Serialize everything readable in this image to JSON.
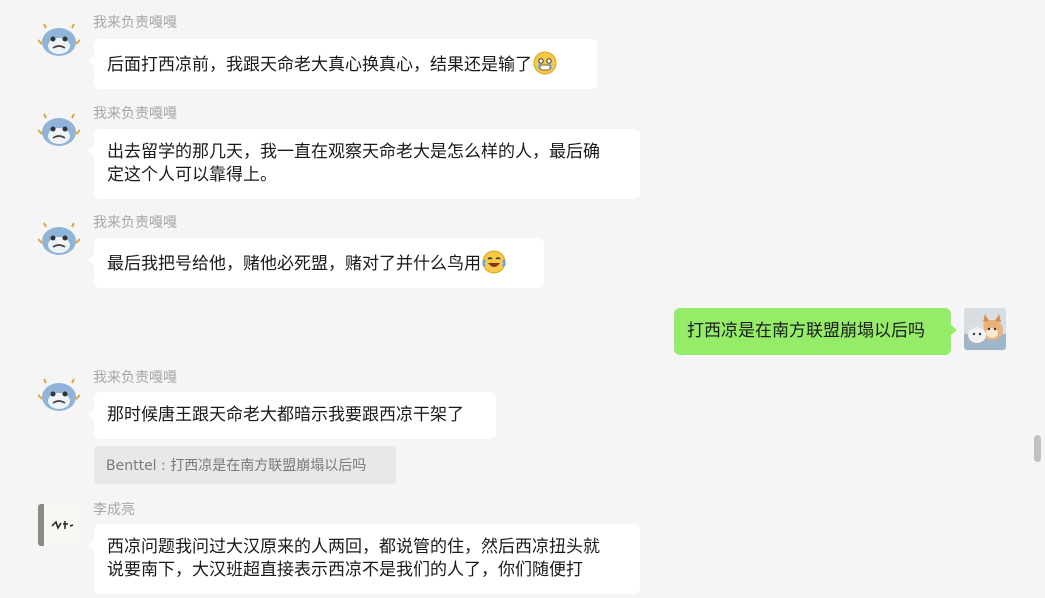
{
  "conversation": {
    "messages": [
      {
        "sender": "我来负责嘎嘎",
        "text": "后面打西凉前，我跟天命老大真心换真心，结果还是输了",
        "emoji": "crying-face-emoji"
      },
      {
        "sender": "我来负责嘎嘎",
        "text": "出去留学的那几天，我一直在观察天命老大是怎么样的人，最后确\n定这个人可以靠得上。"
      },
      {
        "sender": "我来负责嘎嘎",
        "text": "最后我把号给他，赌他必死盟，赌对了并什么鸟用",
        "emoji": "tears-of-joy-emoji"
      },
      {
        "sender": "me",
        "text": "打西凉是在南方联盟崩塌以后吗"
      },
      {
        "sender": "我来负责嘎嘎",
        "text": "那时候唐王跟天命老大都暗示我要跟西凉干架了",
        "quote": "Benttel : 打西凉是在南方联盟崩塌以后吗"
      },
      {
        "sender": "李成亮",
        "text": "西凉问题我问过大汉原来的人两回，都说管的住，然后西凉扭头就\n说要南下，大汉班超直接表示西凉不是我们的人了，你们随便打"
      }
    ]
  },
  "colors": {
    "background": "#f5f5f5",
    "incoming_bubble": "#ffffff",
    "outgoing_bubble": "#95ec69",
    "sender_name": "#a6a6a6",
    "quote_bg": "#e8e8e8"
  },
  "icons": {
    "contact_avatar_1": "blue-cartoon-whale-avatar",
    "contact_avatar_2": "handwriting-photo-avatar",
    "self_avatar": "cat-and-dog-photo-avatar"
  }
}
